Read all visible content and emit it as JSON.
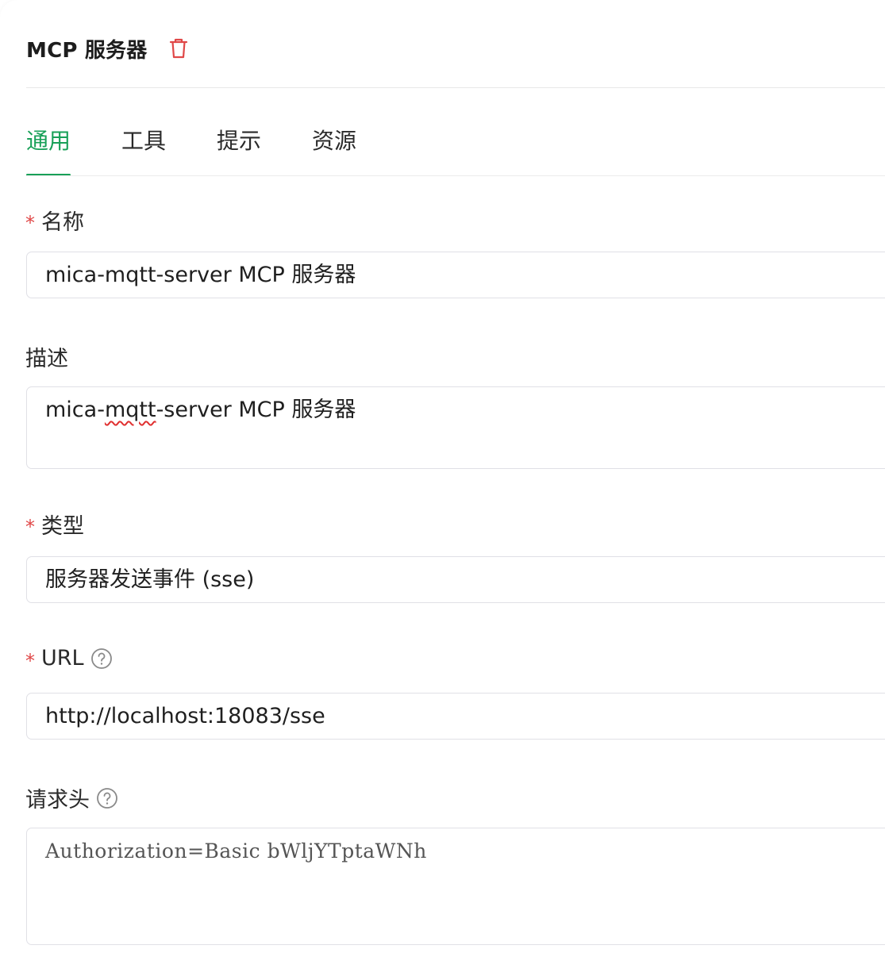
{
  "header": {
    "title": "MCP 服务器",
    "delete_icon": "trash-icon",
    "delete_color": "#e04848"
  },
  "tabs": [
    {
      "label": "通用",
      "active": true
    },
    {
      "label": "工具",
      "active": false
    },
    {
      "label": "提示",
      "active": false
    },
    {
      "label": "资源",
      "active": false
    }
  ],
  "accent_color": "#18a058",
  "form": {
    "name": {
      "label": "名称",
      "required": true,
      "value": "mica-mqtt-server MCP 服务器"
    },
    "description": {
      "label": "描述",
      "required": false,
      "value_prefix": "mica-",
      "value_misspelled": "mqtt",
      "value_suffix": "-server MCP 服务器"
    },
    "type": {
      "label": "类型",
      "required": true,
      "value": "服务器发送事件 (sse)"
    },
    "url": {
      "label": "URL",
      "required": true,
      "help_icon": "question-circle-icon",
      "value": "http://localhost:18083/sse"
    },
    "headers": {
      "label": "请求头",
      "required": false,
      "help_icon": "question-circle-icon",
      "placeholder": "Authorization=Basic bWljYTptaWNh"
    }
  }
}
